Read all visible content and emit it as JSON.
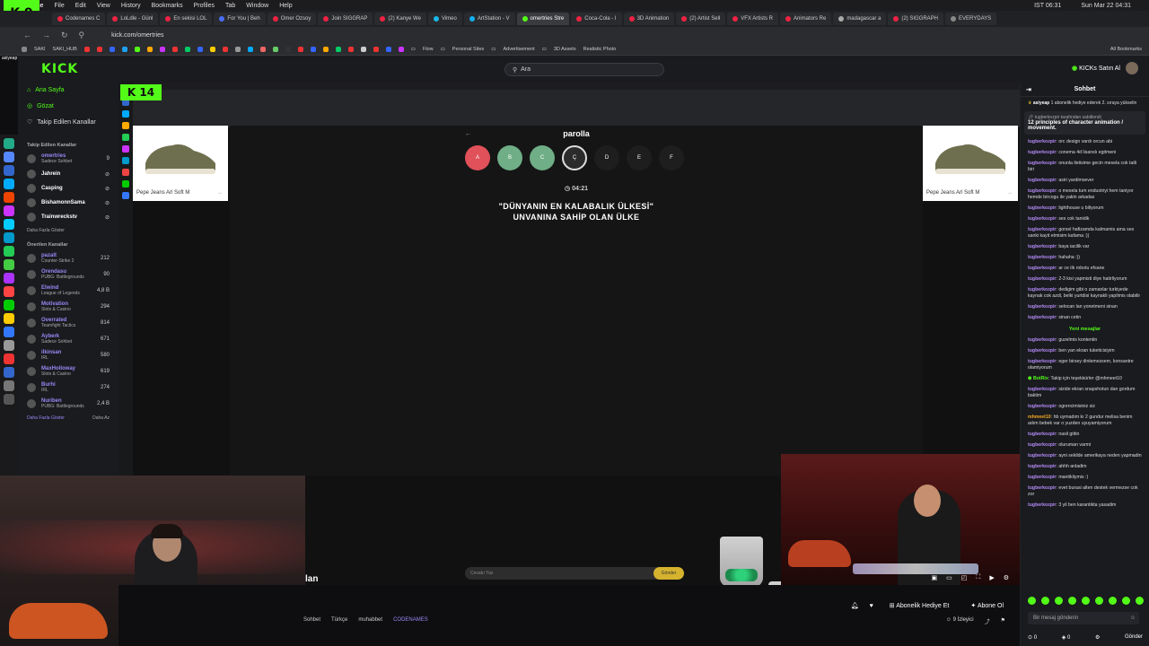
{
  "mac_menu": {
    "app": "Chrome",
    "items": [
      "File",
      "Edit",
      "View",
      "History",
      "Bookmarks",
      "Profiles",
      "Tab",
      "Window",
      "Help"
    ],
    "status_time": "Sun Mar 22 04:31",
    "clock_ist": "IST 06:31"
  },
  "logo_overlay": "K 9",
  "browser": {
    "tabs": [
      "Codenames C",
      "LoLdle - Günl",
      "En sekisi LOL",
      "For You | Beh",
      "Omer Ozsoy",
      "Join SIGGRAP",
      "(2) Kanye We",
      "Vimeo",
      "ArtStation - V",
      "omertries Stre",
      "Coca-Cola - I",
      "3D Animation",
      "(2) Artist Sell",
      "VFX Artists R",
      "Animators Re",
      "madagascar a",
      "(2) SIGGRAPH",
      "EVERYDAYS"
    ],
    "url": "kick.com/omertries",
    "bookmarks": [
      "SAKI",
      "SAKI_HUB",
      "Flow",
      "Personal Sites",
      "Advertisement",
      "3D Assets",
      "Realistic Photo"
    ],
    "all_bookmarks": "All Bookmarks"
  },
  "header": {
    "logo": "KICK",
    "search_placeholder": "Ara",
    "kicks_label": "KICKs Satın Al"
  },
  "sidebar": {
    "user": "asiyeap",
    "links": [
      "Ana Sayfa",
      "Gözat",
      "Takip Edilen Kanallar"
    ],
    "followed_heading": "Takip Edilen Kanallar",
    "followed": [
      {
        "name": "omertries",
        "sub": "Sadece Sohbet",
        "count": "9",
        "live": true
      },
      {
        "name": "Jahrein",
        "sub": "",
        "count": "",
        "live": false
      },
      {
        "name": "Casping",
        "sub": "",
        "count": "",
        "live": false
      },
      {
        "name": "BishamonnSama",
        "sub": "",
        "count": "",
        "live": false
      },
      {
        "name": "Trainwreckstv",
        "sub": "",
        "count": "",
        "live": false
      }
    ],
    "show_more": "Daha Fazla Göster",
    "recommended_heading": "Önerilen Kanallar",
    "recommended": [
      {
        "name": "pazalt",
        "sub": "Counter-Strike 2",
        "count": "212"
      },
      {
        "name": "Orendasu",
        "sub": "PUBG: Battlegrounds",
        "count": "90"
      },
      {
        "name": "Elwind",
        "sub": "League of Legends",
        "count": "4,8 B"
      },
      {
        "name": "Motivation",
        "sub": "Slots & Casino",
        "count": "294"
      },
      {
        "name": "Overrated",
        "sub": "Teamfight Tactics",
        "count": "814"
      },
      {
        "name": "Ayberk",
        "sub": "Sadece Sohbet",
        "count": "671"
      },
      {
        "name": "ilkinsan",
        "sub": "IRL",
        "count": "580"
      },
      {
        "name": "MaxHolloway",
        "sub": "Slots & Casino",
        "count": "619"
      },
      {
        "name": "Burhi",
        "sub": "IRL",
        "count": "274"
      },
      {
        "name": "Nuriben",
        "sub": "PUBG: Battlegrounds",
        "count": "2,4 B"
      }
    ],
    "show_less": "Daha Fazla Göster",
    "show_less2": "Daha Az"
  },
  "stream": {
    "overlay_badge": "K 14",
    "game_title": "parolla",
    "letters": [
      {
        "char": "A",
        "color": "#e0515a"
      },
      {
        "char": "B",
        "color": "#6fae86"
      },
      {
        "char": "C",
        "color": "#6fae86"
      },
      {
        "char": "Ç",
        "color": "#2b2b2b"
      },
      {
        "char": "D",
        "color": "#1e1e1e"
      },
      {
        "char": "E",
        "color": "#1e1e1e"
      },
      {
        "char": "F",
        "color": "#1e1e1e"
      }
    ],
    "timer": "04:21",
    "question_line1": "\"DÜNYANIN EN KALABALIK ÜLKESİ\"",
    "question_line2": "UNVANINA SAHİP OLAN ÜLKE",
    "answer_placeholder": "Cevabı Yaz",
    "answer_button": "Gönder",
    "ad_label": "Pepe Jeans Arl Soft M",
    "lan_text": "lan"
  },
  "below": {
    "tags": [
      "Sohbet",
      "Türkçe",
      "muhabbet",
      "CODENAMES"
    ],
    "gift_button": "Abonelik Hediye Et",
    "subscribe_button": "Abone Ol",
    "viewers": "9 İzleyici"
  },
  "chat": {
    "title": "Sohbet",
    "sub_notice": "1 abonelik hediye ederek 2. sıraya yükselin",
    "sub_user": "asiyeap",
    "pinned_by": "tugberkozpir tarafından sabitlendi",
    "pinned_text": "12 principles of character animation / movement.",
    "messages": [
      {
        "user": "tugberkozpir",
        "text": "orc design vardı orcun abi"
      },
      {
        "user": "tugberkozpir",
        "text": "conema 4d lisanslı egitmeni"
      },
      {
        "user": "tugberkozpir",
        "text": "onunla iletisime gecin mesela cok tatli biri"
      },
      {
        "user": "tugberkozpir",
        "text": "asiri yardimsever"
      },
      {
        "user": "tugberkozpir",
        "text": "o mesela tum endustriyi hem taniyor hemde bircogu ile yakin arkadas"
      },
      {
        "user": "tugberkozpir",
        "text": "lighthouse u biliyorum"
      },
      {
        "user": "tugberkozpir",
        "text": "ses cok tanidik"
      },
      {
        "user": "tugberkozpir",
        "text": "gorsel hafizamda kalmamis ama ses sanki kayit etmisim kafama :))"
      },
      {
        "user": "tugberkozpir",
        "text": "baya iacilik var"
      },
      {
        "user": "tugberkozpir",
        "text": "hahaha :))"
      },
      {
        "user": "tugberkozpir",
        "text": "ar ce ilk robotu efsane"
      },
      {
        "user": "tugberkozpir",
        "text": "2-3 kisi yapmisti diye hatirliyorum"
      },
      {
        "user": "tugberkozpir",
        "text": "dedigim gibi o zamanlar turkiyede kaynak cok azdi, belki yurtdisi kaynakli yapilmis olabilir"
      },
      {
        "user": "tugberkozpir",
        "text": "selocan lan yonetmeni sinan"
      },
      {
        "user": "tugberkozpir",
        "text": "sinan cetin"
      }
    ],
    "new_messages": "Yeni mesajlar",
    "messages2": [
      {
        "user": "tugberkozpir",
        "text": "guzelmis kontentin"
      },
      {
        "user": "tugberkozpir",
        "text": "ben yan ekran tuketicisiyim"
      },
      {
        "user": "tugberkozpir",
        "text": "eger birsey dinlemezsem, konsantre olamiyorum"
      },
      {
        "user": "BotRix",
        "text": "Takip için teşekkürler @mhmeet10",
        "bot": true
      },
      {
        "user": "tugberkozpir",
        "text": "sizide ekran snapshotun dan gordum baktim"
      },
      {
        "user": "tugberkozpir",
        "text": "ogrencimisiniz siz"
      },
      {
        "user": "mhmeet10",
        "text": "hb uymadım kı 2 gundur melisa benim adım bebek var o yuzden uyuyamiyorum"
      },
      {
        "user": "tugberkozpir",
        "text": "nasil gittin"
      },
      {
        "user": "tugberkozpir",
        "text": "oluruman varmi"
      },
      {
        "user": "tugberkozpir",
        "text": "ayni sekilde amerikaya neden yapmadin"
      },
      {
        "user": "tugberkozpir",
        "text": "ahhh anladim"
      },
      {
        "user": "tugberkozpir",
        "text": "mantikliymis :)"
      },
      {
        "user": "tugberkozpir",
        "text": "evet burasi alten destek vermezse cok zor"
      },
      {
        "user": "tugberkozpir",
        "text": "3 yil ben karantikta yasadim"
      }
    ],
    "input_placeholder": "Bir mesaj gönderin",
    "send_button": "Gönder",
    "points": "0",
    "kicks": "0"
  },
  "colors": {
    "accent": "#53fc18",
    "username": "#b48af5",
    "answer_button": "#d6b32e"
  }
}
